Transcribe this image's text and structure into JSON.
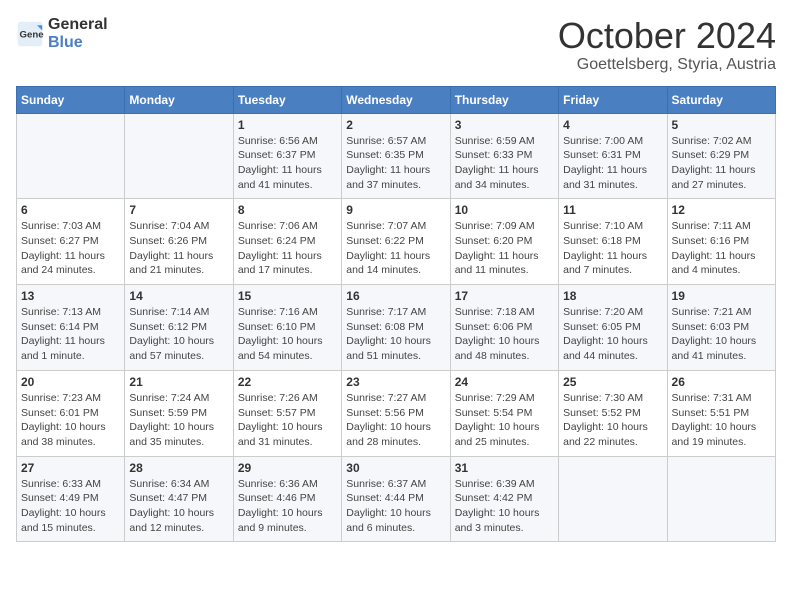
{
  "logo": {
    "text_general": "General",
    "text_blue": "Blue"
  },
  "header": {
    "month": "October 2024",
    "location": "Goettelsberg, Styria, Austria"
  },
  "weekdays": [
    "Sunday",
    "Monday",
    "Tuesday",
    "Wednesday",
    "Thursday",
    "Friday",
    "Saturday"
  ],
  "weeks": [
    [
      {
        "day": "",
        "info": ""
      },
      {
        "day": "",
        "info": ""
      },
      {
        "day": "1",
        "info": "Sunrise: 6:56 AM\nSunset: 6:37 PM\nDaylight: 11 hours and 41 minutes."
      },
      {
        "day": "2",
        "info": "Sunrise: 6:57 AM\nSunset: 6:35 PM\nDaylight: 11 hours and 37 minutes."
      },
      {
        "day": "3",
        "info": "Sunrise: 6:59 AM\nSunset: 6:33 PM\nDaylight: 11 hours and 34 minutes."
      },
      {
        "day": "4",
        "info": "Sunrise: 7:00 AM\nSunset: 6:31 PM\nDaylight: 11 hours and 31 minutes."
      },
      {
        "day": "5",
        "info": "Sunrise: 7:02 AM\nSunset: 6:29 PM\nDaylight: 11 hours and 27 minutes."
      }
    ],
    [
      {
        "day": "6",
        "info": "Sunrise: 7:03 AM\nSunset: 6:27 PM\nDaylight: 11 hours and 24 minutes."
      },
      {
        "day": "7",
        "info": "Sunrise: 7:04 AM\nSunset: 6:26 PM\nDaylight: 11 hours and 21 minutes."
      },
      {
        "day": "8",
        "info": "Sunrise: 7:06 AM\nSunset: 6:24 PM\nDaylight: 11 hours and 17 minutes."
      },
      {
        "day": "9",
        "info": "Sunrise: 7:07 AM\nSunset: 6:22 PM\nDaylight: 11 hours and 14 minutes."
      },
      {
        "day": "10",
        "info": "Sunrise: 7:09 AM\nSunset: 6:20 PM\nDaylight: 11 hours and 11 minutes."
      },
      {
        "day": "11",
        "info": "Sunrise: 7:10 AM\nSunset: 6:18 PM\nDaylight: 11 hours and 7 minutes."
      },
      {
        "day": "12",
        "info": "Sunrise: 7:11 AM\nSunset: 6:16 PM\nDaylight: 11 hours and 4 minutes."
      }
    ],
    [
      {
        "day": "13",
        "info": "Sunrise: 7:13 AM\nSunset: 6:14 PM\nDaylight: 11 hours and 1 minute."
      },
      {
        "day": "14",
        "info": "Sunrise: 7:14 AM\nSunset: 6:12 PM\nDaylight: 10 hours and 57 minutes."
      },
      {
        "day": "15",
        "info": "Sunrise: 7:16 AM\nSunset: 6:10 PM\nDaylight: 10 hours and 54 minutes."
      },
      {
        "day": "16",
        "info": "Sunrise: 7:17 AM\nSunset: 6:08 PM\nDaylight: 10 hours and 51 minutes."
      },
      {
        "day": "17",
        "info": "Sunrise: 7:18 AM\nSunset: 6:06 PM\nDaylight: 10 hours and 48 minutes."
      },
      {
        "day": "18",
        "info": "Sunrise: 7:20 AM\nSunset: 6:05 PM\nDaylight: 10 hours and 44 minutes."
      },
      {
        "day": "19",
        "info": "Sunrise: 7:21 AM\nSunset: 6:03 PM\nDaylight: 10 hours and 41 minutes."
      }
    ],
    [
      {
        "day": "20",
        "info": "Sunrise: 7:23 AM\nSunset: 6:01 PM\nDaylight: 10 hours and 38 minutes."
      },
      {
        "day": "21",
        "info": "Sunrise: 7:24 AM\nSunset: 5:59 PM\nDaylight: 10 hours and 35 minutes."
      },
      {
        "day": "22",
        "info": "Sunrise: 7:26 AM\nSunset: 5:57 PM\nDaylight: 10 hours and 31 minutes."
      },
      {
        "day": "23",
        "info": "Sunrise: 7:27 AM\nSunset: 5:56 PM\nDaylight: 10 hours and 28 minutes."
      },
      {
        "day": "24",
        "info": "Sunrise: 7:29 AM\nSunset: 5:54 PM\nDaylight: 10 hours and 25 minutes."
      },
      {
        "day": "25",
        "info": "Sunrise: 7:30 AM\nSunset: 5:52 PM\nDaylight: 10 hours and 22 minutes."
      },
      {
        "day": "26",
        "info": "Sunrise: 7:31 AM\nSunset: 5:51 PM\nDaylight: 10 hours and 19 minutes."
      }
    ],
    [
      {
        "day": "27",
        "info": "Sunrise: 6:33 AM\nSunset: 4:49 PM\nDaylight: 10 hours and 15 minutes."
      },
      {
        "day": "28",
        "info": "Sunrise: 6:34 AM\nSunset: 4:47 PM\nDaylight: 10 hours and 12 minutes."
      },
      {
        "day": "29",
        "info": "Sunrise: 6:36 AM\nSunset: 4:46 PM\nDaylight: 10 hours and 9 minutes."
      },
      {
        "day": "30",
        "info": "Sunrise: 6:37 AM\nSunset: 4:44 PM\nDaylight: 10 hours and 6 minutes."
      },
      {
        "day": "31",
        "info": "Sunrise: 6:39 AM\nSunset: 4:42 PM\nDaylight: 10 hours and 3 minutes."
      },
      {
        "day": "",
        "info": ""
      },
      {
        "day": "",
        "info": ""
      }
    ]
  ]
}
